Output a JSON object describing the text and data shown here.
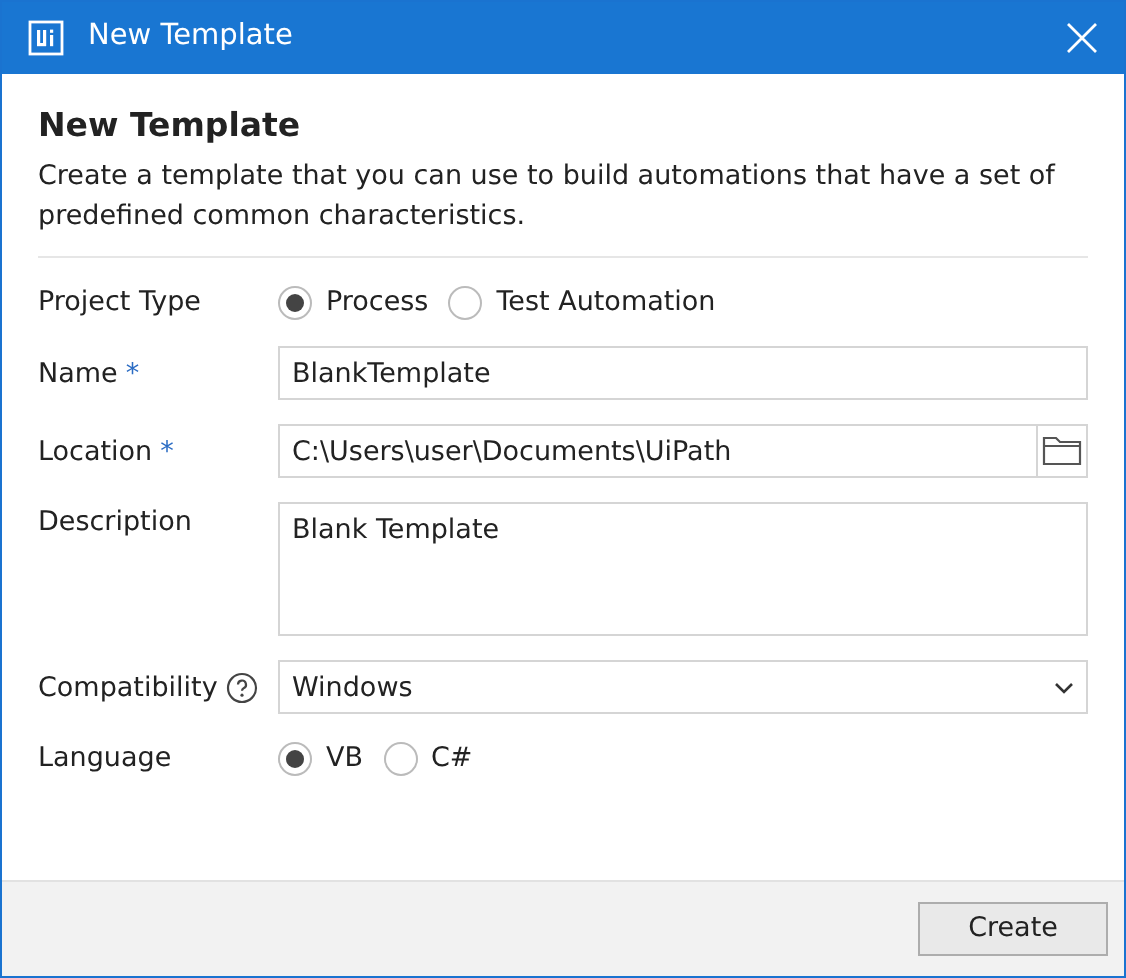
{
  "window": {
    "title": "New Template"
  },
  "heading": "New Template",
  "description": "Create a template that you can use to build automations that have a set of predefined common characteristics.",
  "fields": [
    {
      "kind": "radio",
      "label": "Project Type",
      "options": [
        {
          "label": "Process",
          "selected": true
        },
        {
          "label": "Test Automation",
          "selected": false
        }
      ]
    },
    {
      "kind": "text",
      "label": "Name",
      "required_mark": "*",
      "value": "BlankTemplate"
    },
    {
      "kind": "folder",
      "label": "Location",
      "required_mark": "*",
      "value": "C:\\Users\\user\\Documents\\UiPath"
    },
    {
      "kind": "textarea",
      "label": "Description",
      "value": "Blank Template"
    },
    {
      "kind": "select",
      "label": "Compatibility",
      "help": true,
      "value": "Windows"
    },
    {
      "kind": "radio",
      "label": "Language",
      "options": [
        {
          "label": "VB",
          "selected": true
        },
        {
          "label": "C#",
          "selected": false
        }
      ]
    }
  ],
  "buttons": [
    {
      "label": "Create"
    }
  ]
}
